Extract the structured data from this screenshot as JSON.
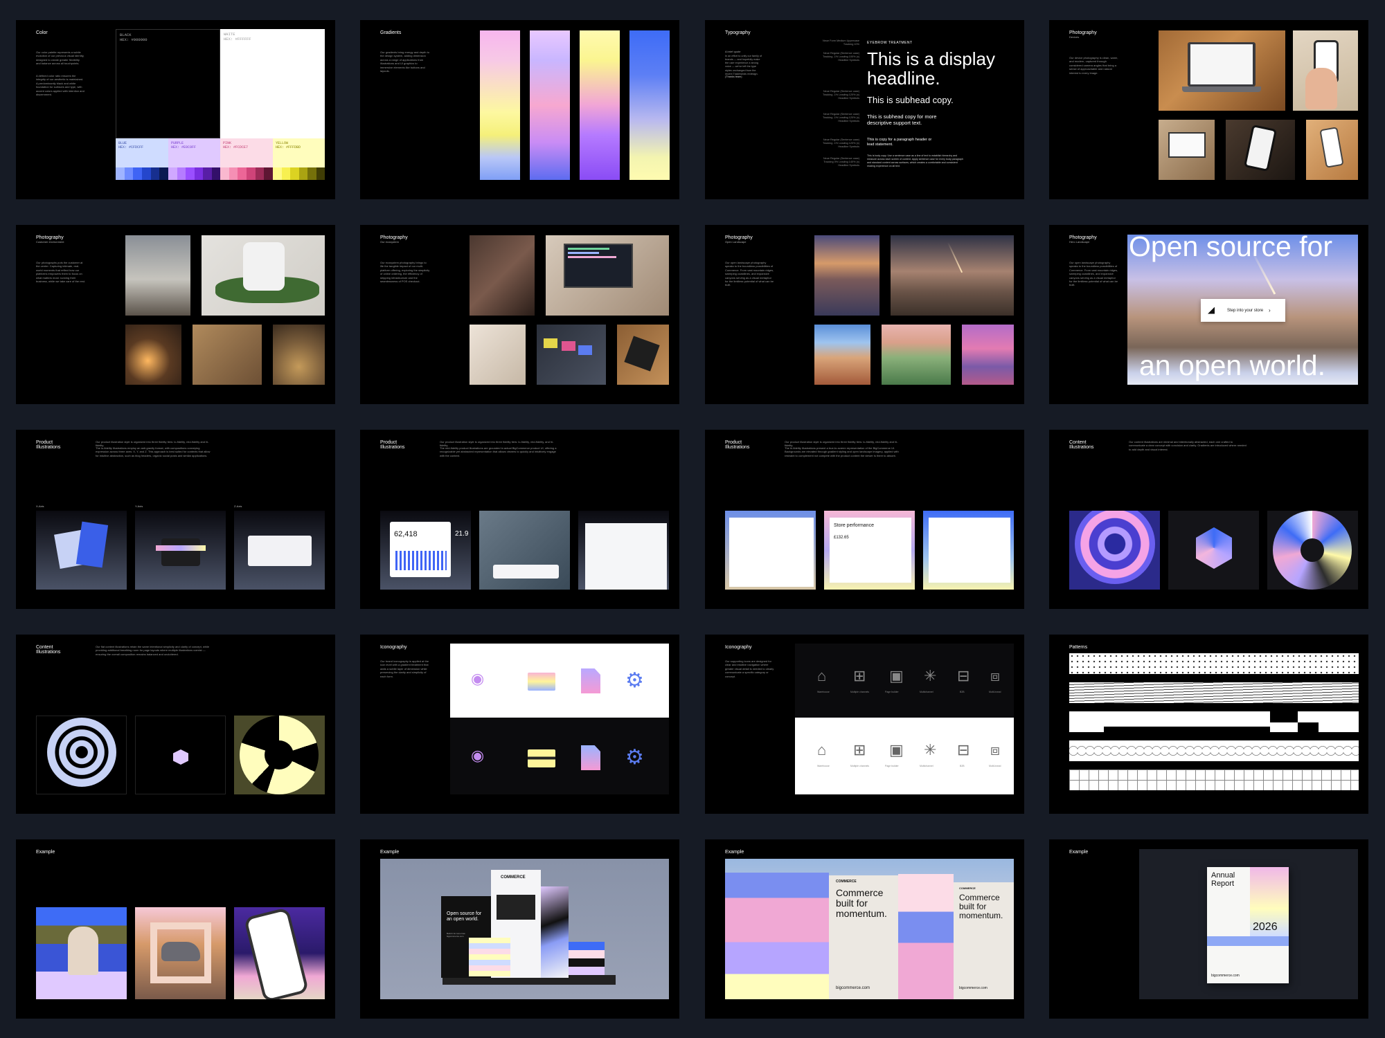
{
  "colors": {
    "page_bg": "#161b25",
    "slide_bg": "#000000",
    "blue": "#CFDCFF",
    "purple": "#E0C9FF",
    "pink": "#FCDCE7",
    "yellow": "#FFFDBD"
  },
  "color_slide": {
    "title": "Color",
    "body1": "Our color palette represents a subtle evolution of our previous visual identity, designed to create greater flexibility and balance across all touchpoints.",
    "body2": "A defined color ratio ensures the integrity of our aesthetic is maintained. A predominantly black and white foundation for surfaces and type, with accent colors applied with intention and discernment.",
    "black_name": "BLACK",
    "black_hex": "HEX: #000000",
    "white_name": "WHITE",
    "white_hex": "HEX: #FFFFFF",
    "blue_name": "BLUE",
    "blue_hex": "HEX: #CFDCFF",
    "purple_name": "PURPLE",
    "purple_hex": "HEX: #E0C9FF",
    "pink_name": "PINK",
    "pink_hex": "HEX: #FCDCE7",
    "yellow_name": "YELLOW",
    "yellow_hex": "HEX: #FFFDBD"
  },
  "gradients_slide": {
    "title": "Gradients",
    "body": "Our gradients bring energy and depth to the design system, adding dimension across a range of applications from illustrations and UI graphics to immersive elements like buttons and layouts."
  },
  "typography_slide": {
    "title": "Typography",
    "sub": "A brief quote",
    "body": "In an effort to unify our family of brands — and hopefully make the user experience a strong voice — we've left the type styles unchanged from the recent Tradewinds redesign.",
    "credit": "(Thanks team)",
    "eyebrow": "EYEBROW TREATMENT",
    "display": "This is a display headline.",
    "subhead": "This is subhead copy.",
    "subhead2": "This is subhead copy for more descriptive support text.",
    "lead": "This is copy for a paragraph header or lead statement.",
    "paragraph": "This is body copy. Use a sentence case as a line of text to establish hierarchy and measure across each screen of content. Apply sentence case for every body paragraph and standard content across surfaces, which creates a comfortable and consistent reading experience on all text.",
    "notes": [
      "Neue Form Medium Uppercase\nTracking 10%",
      "Neue Regular (Sentence case)\nTracking -1% Leading 100%\n(x) Headline Symbols",
      "Neue Regular (Sentence case)\nTracking -1% Leading 120%\n(x) Headline Symbols",
      "Neue Regular (Sentence case)\nTracking -1% Leading 120%\n(x) Headline Symbols",
      "Neue Regular (Sentence case)\nTracking -1% Leading 120%\n(x) Headline Symbols",
      "Neue Regular (Sentence case)\nTracking 0% Leading 140%\n(x) Headline Symbols"
    ]
  },
  "photo_devices": {
    "title": "Photography",
    "sub": "Devices",
    "body": "Our device photography is clean, warm, and modern, captured through considered camera angles that bring a sense of approachable and natural interest to every image."
  },
  "photo_customer": {
    "title": "Photography",
    "sub": "Customer environment",
    "body": "Our photographs puts the customer at the center. Capturing intimate, real-world moments that reflect how our platforms empowers them to focus on what matters most: running their business, while we take care of the rest."
  },
  "photo_ecosystem": {
    "title": "Photography",
    "sub": "Our ecosystem",
    "body": "Our ecosystem photography brings to life the tangible impact of our multi-platform offering, exploring the simplicity of online ordering, the efficiency of shipping infrastructure and the seamlessness of POS checkout."
  },
  "photo_landscape": {
    "title": "Photography",
    "sub": "Open Landscape",
    "body": "Our open landscape photography speaks to the boundless possibilities of Commerce. From vast mountain ridges, sweeping coastlines, and expansive canyons serving as a visual metaphor for the limitless potential of what can be built."
  },
  "photo_hero": {
    "title": "Photography",
    "sub": "Hero Landscape",
    "body": "Our open landscape photography speaks to the boundless possibilities of Commerce. From vast mountain ridges, sweeping coastlines, and expansive canyons serving as a visual metaphor for the limitless potential of what can be built.",
    "line1": "Open source for",
    "line2": "an open world.",
    "button": "Step into your store"
  },
  "product_illus_1": {
    "title": "Product Illustrations",
    "body": "Our product illustration style is organized into three fidelity tiers: lo-fidelity, mid-fidelity and hi-fidelity.",
    "body2": "The lo-fidelity illustrations employ an anti-gravity format, with compositions conveying expression across three axes: X, Y, and Z. This approach is best suited for contexts that allow for intuitive abstraction, such as blog headers, organic social posts and similar applications.",
    "captions": [
      "X-Axis",
      "Y-Axis",
      "Z-Axis"
    ]
  },
  "product_illus_2": {
    "title": "Product Illustrations",
    "body": "Our product illustration style is organized into three fidelity tiers: lo-fidelity, mid-fidelity, and hi-fidelity.",
    "body2": "The mid-fidelity product illustrations are grounded in actual BigCommerce product UI, offering a recognizable yet abstracted representation that allows viewers to quickly and intuitively engage with the content.",
    "stat": "62,418",
    "stat2": "21.9"
  },
  "product_illus_3": {
    "title": "Product Illustrations",
    "body": "Our product illustration style is organized into three fidelity tiers: lo-fidelity, mid-fidelity and hi-fidelity.",
    "body2": "The hi-fidelity illustrations present a true-to-screen representation of the BigCommerce UI. Backgrounds are elevated through gradient styling and open landscape imagery, applied with restraint to complement not compete with the product content the viewer is there to absorb.",
    "perf": "Store performance",
    "v1": "£132.65"
  },
  "content_illus_1": {
    "title": "Content Illustrations",
    "body": "Our content illustrations are minimal and intentionally abstracted, each one crafted to communicate a clear concept with concision and clarity. Gradients are introduced where needed to add depth and visual interest."
  },
  "content_illus_2": {
    "title": "Content Illustrations",
    "body": "Our flat content illustrations retain the same intentional simplicity and clarity of concept, while providing additional breathing room for page layouts where multiple illustrations coexist — ensuring the overall composition remains balanced and uncluttered."
  },
  "iconography_1": {
    "title": "Iconography",
    "body": "Our brand iconography is applied at the icon level with a gradient treatment that adds a subtle layer of dimension while preserving the clarity and simplicity of each form."
  },
  "iconography_2": {
    "title": "Iconography",
    "body": "Our supporting icons are designed for clear and intuitive navigation where greater visual detail is needed to clearly communicate a specific category or concept.",
    "captions": [
      "Warehouse",
      "Multiple channels",
      "Page builder",
      "Multichannel",
      "B2B",
      "Multi-brand"
    ]
  },
  "patterns": {
    "title": "Patterns"
  },
  "example_1": {
    "title": "Example"
  },
  "example_2": {
    "title": "Example",
    "brand": "COMMERCE",
    "headline": "Open source for an open world.",
    "small": "Build it for tomorrow\nbigcommerce.com"
  },
  "example_3": {
    "title": "Example",
    "brand": "COMMERCE",
    "headline": "Commerce built for momentum.",
    "url": "bigcommerce.com"
  },
  "example_4": {
    "title": "Example",
    "report_title": "Annual Report",
    "year": "2026",
    "url": "bigcommerce.com"
  }
}
